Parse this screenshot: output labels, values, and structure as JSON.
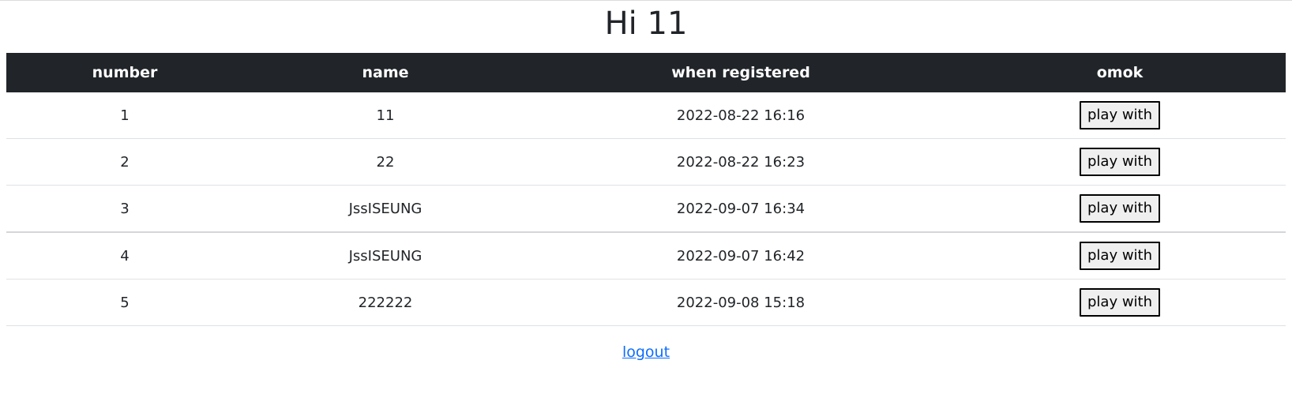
{
  "header": {
    "title": "Hi 11"
  },
  "table": {
    "columns": [
      "number",
      "name",
      "when registered",
      "omok"
    ],
    "rows": [
      {
        "number": "1",
        "name": "11",
        "registered": "2022-08-22 16:16",
        "action": "play with"
      },
      {
        "number": "2",
        "name": "22",
        "registered": "2022-08-22 16:23",
        "action": "play with"
      },
      {
        "number": "3",
        "name": "JssISEUNG",
        "registered": "2022-09-07 16:34",
        "action": "play with"
      },
      {
        "number": "4",
        "name": "JssISEUNG",
        "registered": "2022-09-07 16:42",
        "action": "play with"
      },
      {
        "number": "5",
        "name": "222222",
        "registered": "2022-09-08 15:18",
        "action": "play with"
      }
    ]
  },
  "footer": {
    "logout_label": "logout"
  },
  "colors": {
    "header_bg": "#212529",
    "header_text": "#ffffff",
    "link": "#0d6efd",
    "row_border": "#dee2e6"
  }
}
